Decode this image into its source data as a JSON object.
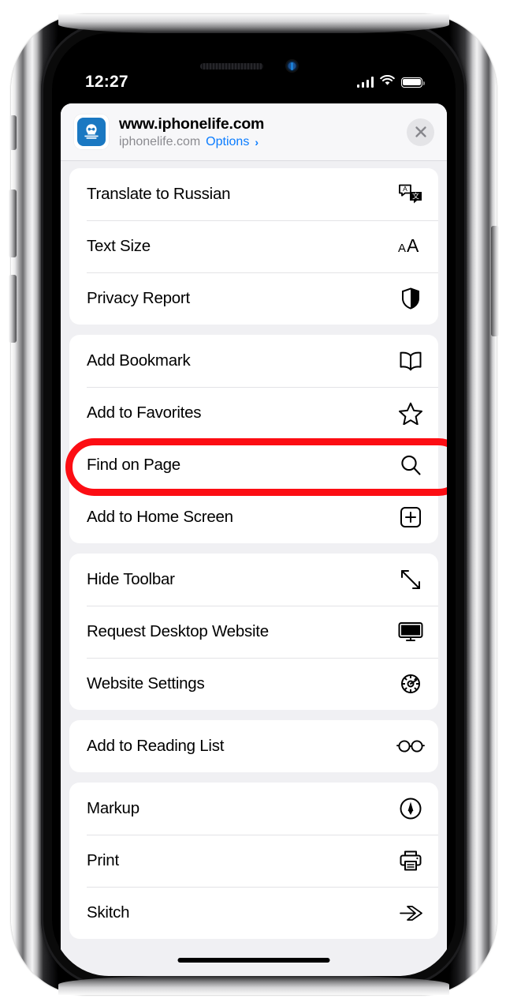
{
  "status_bar": {
    "time": "12:27",
    "cellular_icon": "signal-bars-icon",
    "wifi_icon": "wifi-icon",
    "battery_icon": "battery-full-icon"
  },
  "share_sheet": {
    "header": {
      "favicon_icon": "iphonelife-favicon",
      "title": "www.iphonelife.com",
      "subtitle": "iphonelife.com",
      "options_label": "Options",
      "options_chevron": "chevron-right-icon",
      "close_icon": "close-icon"
    },
    "groups": [
      {
        "id": "group-page-tools",
        "rows": [
          {
            "label": "Translate to Russian",
            "icon": "translate-icon"
          },
          {
            "label": "Text Size",
            "icon": "text-size-icon"
          },
          {
            "label": "Privacy Report",
            "icon": "shield-icon"
          }
        ]
      },
      {
        "id": "group-bookmarks",
        "rows": [
          {
            "label": "Add Bookmark",
            "icon": "book-icon"
          },
          {
            "label": "Add to Favorites",
            "icon": "star-icon",
            "highlighted": true
          },
          {
            "label": "Find on Page",
            "icon": "search-icon"
          },
          {
            "label": "Add to Home Screen",
            "icon": "plus-square-icon"
          }
        ]
      },
      {
        "id": "group-view",
        "rows": [
          {
            "label": "Hide Toolbar",
            "icon": "expand-arrows-icon"
          },
          {
            "label": "Request Desktop Website",
            "icon": "desktop-icon"
          },
          {
            "label": "Website Settings",
            "icon": "gear-icon"
          }
        ]
      },
      {
        "id": "group-reading",
        "rows": [
          {
            "label": "Add to Reading List",
            "icon": "glasses-icon"
          }
        ]
      },
      {
        "id": "group-actions",
        "rows": [
          {
            "label": "Markup",
            "icon": "markup-pen-icon"
          },
          {
            "label": "Print",
            "icon": "printer-icon"
          },
          {
            "label": "Skitch",
            "icon": "skitch-icon"
          }
        ]
      }
    ]
  },
  "annotation": {
    "highlight_color": "#fc0d13",
    "highlight_target": "Add to Favorites"
  },
  "home_indicator": "home-indicator"
}
